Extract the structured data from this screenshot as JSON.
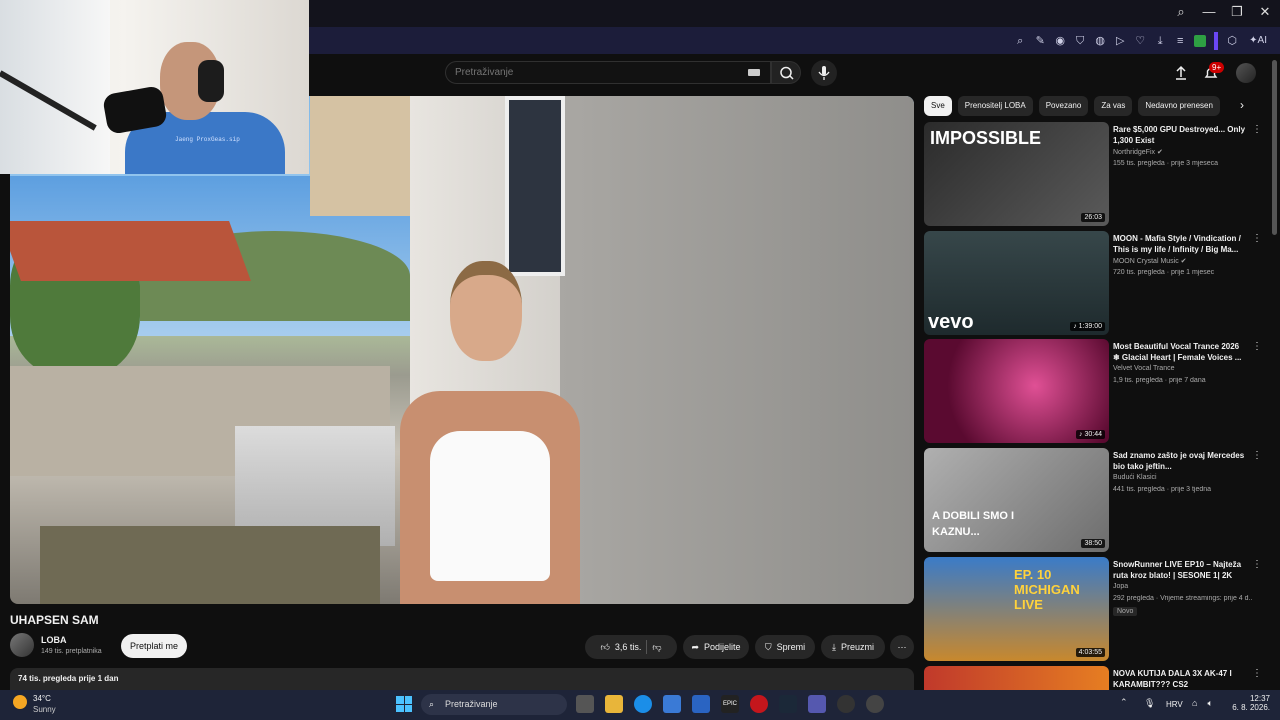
{
  "youtube": {
    "search_placeholder": "Pretraživanje",
    "notif_badge": "9+"
  },
  "video": {
    "title": "UHAPSEN SAM",
    "channel": "LOBA",
    "subscribers": "149 tis. pretplatnika",
    "subscribe_label": "Pretplati me",
    "likes": "3,6 tis.",
    "share_label": "Podijelite",
    "save_label": "Spremi",
    "download_label": "Preuzmi",
    "views_date": "74 tis. pregleda  prije 1 dan"
  },
  "chips": [
    "Sve",
    "Prenositelj LOBA",
    "Povezano",
    "Za vas",
    "Nedavno prenesen"
  ],
  "recommendations": [
    {
      "title": "Rare $5,000 GPU Destroyed... Only 1,300 Exist",
      "channel": "NorthridgeFix ✔",
      "meta": "155 tis. pregleda · prije 3 mjeseca",
      "duration": "26:03",
      "thumb_text": "IMPOSSIBLE",
      "thumb_bg": "#3b3b3b"
    },
    {
      "title": "MOON - Mafia Style / Vindication / This is my life / Infinity / Big Ma...",
      "channel": "MOON Crystal Music ✔",
      "meta": "720 tis. pregleda · prije 1 mjesec",
      "duration": "♪ 1:39:00",
      "thumb_text": "vevo",
      "thumb_bg": "#2a3a40"
    },
    {
      "title": "Most Beautiful Vocal Trance 2026 ❄ Glacial Heart | Female Voices ...",
      "channel": "Velvet Vocal Trance",
      "meta": "1,9 tis. pregleda · prije 7 dana",
      "duration": "♪ 30:44",
      "thumb_text": "",
      "thumb_bg": "#7a1046"
    },
    {
      "title": "Sad znamo zašto je ovaj Mercedes bio tako jeftin...",
      "channel": "Budući Klasici",
      "meta": "441 tis. pregleda · prije 3 tjedna",
      "duration": "38:50",
      "thumb_text": "A DOBILI SMO I KAZNU...",
      "thumb_bg": "#8e8e8e"
    },
    {
      "title": "SnowRunner LIVE EP10 – Najteža ruta kroz blato! | SESONE 1| 2K",
      "channel": "Jopa",
      "meta": "292 pregleda · Vrijeme streamings: prije 4 d...",
      "duration": "4:03:55",
      "thumb_text": "EP. 10 MICHIGAN LIVE",
      "thumb_bg": "#2c5a8a",
      "badge": "Novo"
    },
    {
      "title": "NOVA KUTIJA DALA 3X AK-47 I KARAMBIT??? CS2",
      "channel": "",
      "meta": "",
      "duration": "",
      "thumb_text": "",
      "thumb_bg": "#c0392b"
    }
  ],
  "taskbar": {
    "temperature": "34°C",
    "condition": "Sunny",
    "search_label": "Pretraživanje",
    "language": "HRV",
    "time": "12:37",
    "date": "6. 8. 2026."
  },
  "webcam_overlay_text": "Jaeng ProxGeas.sip"
}
